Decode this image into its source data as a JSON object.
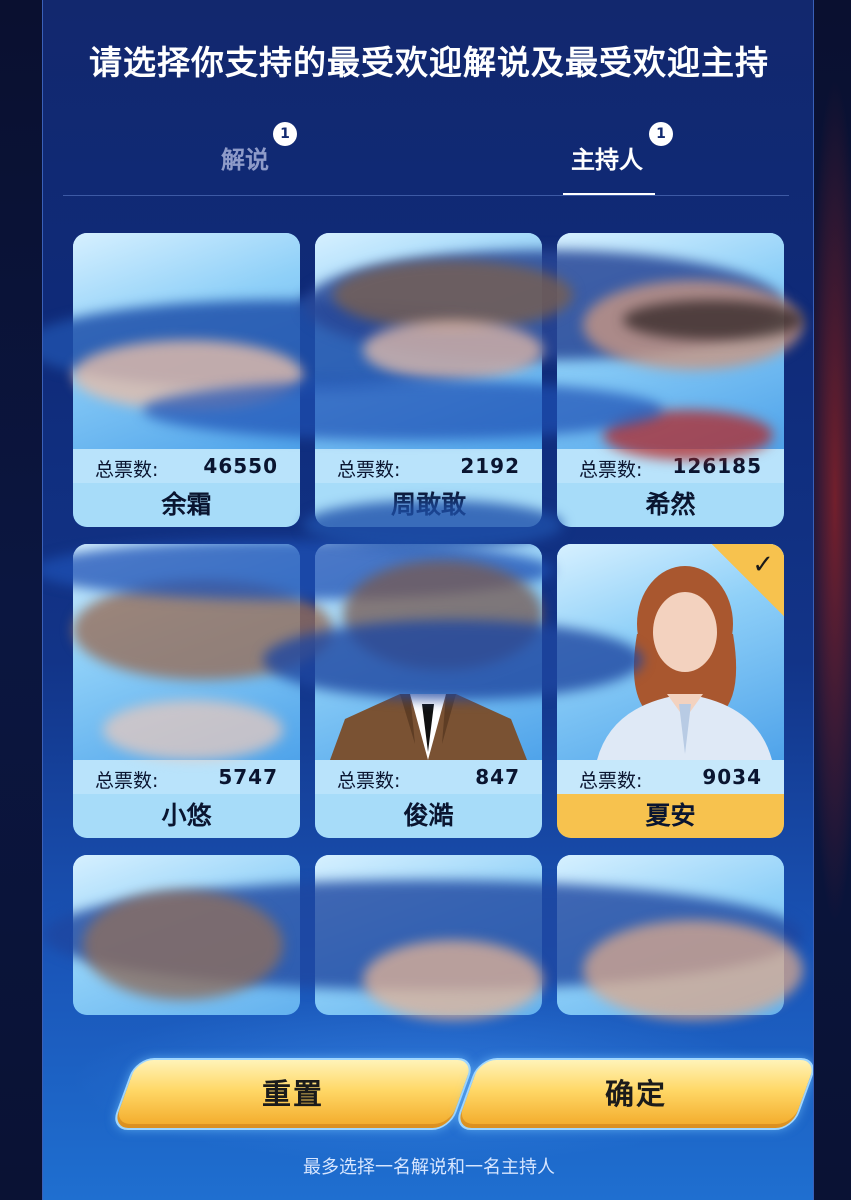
{
  "page": {
    "title": "请选择你支持的最受欢迎解说及最受欢迎主持",
    "footer_note": "最多选择一名解说和一名主持人"
  },
  "tabs": [
    {
      "label": "解说",
      "badge": "1",
      "active": false
    },
    {
      "label": "主持人",
      "badge": "1",
      "active": true
    }
  ],
  "stats_label": "总票数:",
  "cards": [
    {
      "name": "余霜",
      "votes": "46550",
      "selected": false
    },
    {
      "name": "周敢敢",
      "votes": "2192",
      "selected": false
    },
    {
      "name": "希然",
      "votes": "126185",
      "selected": false
    },
    {
      "name": "小悠",
      "votes": "5747",
      "selected": false
    },
    {
      "name": "俊澔",
      "votes": "847",
      "selected": false
    },
    {
      "name": "夏安",
      "votes": "9034",
      "selected": true
    }
  ],
  "buttons": {
    "reset": "重置",
    "confirm": "确定"
  },
  "icons": {
    "selected_check": "check-icon"
  },
  "colors": {
    "accent_gold": "#f7c24e",
    "panel_blue": "#12286e"
  }
}
